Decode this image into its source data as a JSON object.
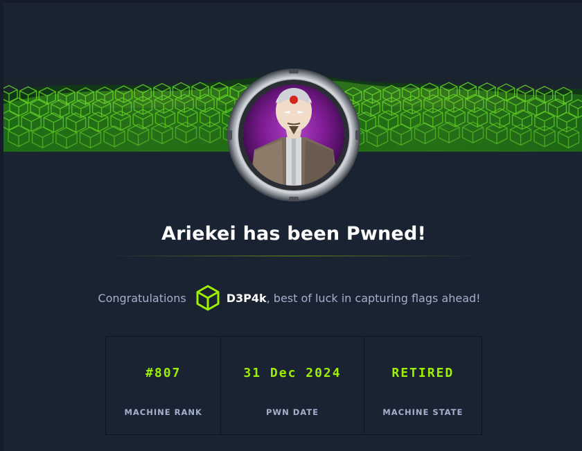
{
  "header": {
    "title": "Ariekei has been Pwned!"
  },
  "banner": {
    "icon": "cube-grid-banner",
    "accent_color": "#9fef00"
  },
  "avatar": {
    "icon": "machine-avatar-ariekei"
  },
  "congrats": {
    "prefix": "Congratulations",
    "icon": "hexagon-cube-icon",
    "username": "D3P4k",
    "suffix": ", best of luck in capturing flags ahead!"
  },
  "stats": [
    {
      "value": "#807",
      "label": "MACHINE RANK"
    },
    {
      "value": "31 Dec 2024",
      "label": "PWN DATE"
    },
    {
      "value": "RETIRED",
      "label": "MACHINE STATE"
    }
  ],
  "colors": {
    "background": "#1a2332",
    "accent": "#9fef00",
    "muted_text": "#a4b1cd"
  }
}
